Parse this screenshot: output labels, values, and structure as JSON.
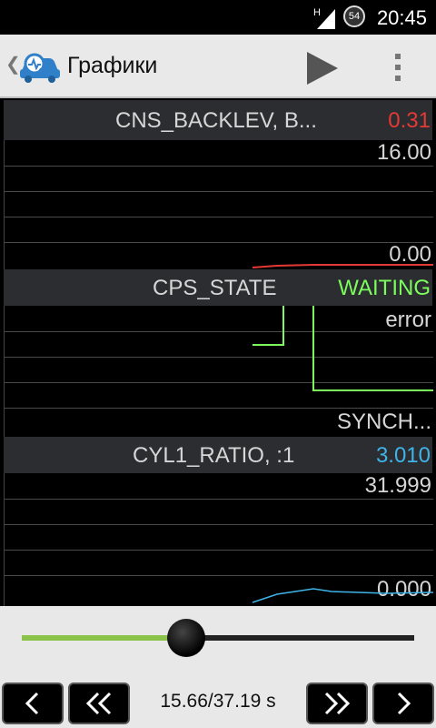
{
  "status_bar": {
    "time": "20:45",
    "network_type": "H",
    "battery_level": "54"
  },
  "action_bar": {
    "title": "Графики",
    "app_icon": "car-diagnostics-icon",
    "play_icon": "play-icon",
    "overflow_icon": "overflow-menu-icon"
  },
  "panels": [
    {
      "name": "CNS_BACKLEV, B...",
      "value": "0.31",
      "value_color": "#e53935",
      "top_label": "16.00",
      "bottom_label": "0.00",
      "line_color": "#e53935"
    },
    {
      "name": "CPS_STATE",
      "value": "WAITING",
      "value_color": "#7cfc5c",
      "top_label": "error",
      "bottom_label": "SYNCH...",
      "line_color": "#7cfc5c"
    },
    {
      "name": "CYL1_RATIO, :1",
      "value": "3.010",
      "value_color": "#3fb4e8",
      "top_label": "31.999",
      "bottom_label": "0.000",
      "line_color": "#3fb4e8"
    }
  ],
  "playback": {
    "position_fraction": 0.42,
    "time_display": "15.66/37.19 s",
    "buttons": {
      "prev": "‹",
      "rewind": "«",
      "forward": "»",
      "next": "›"
    }
  }
}
